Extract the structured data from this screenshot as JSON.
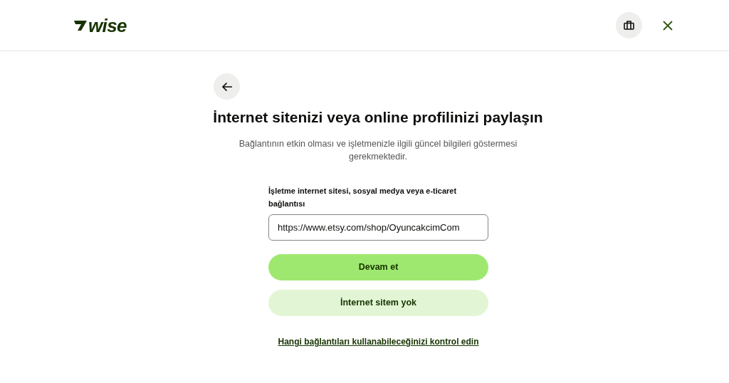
{
  "header": {
    "logo_text": "wise"
  },
  "title": "İnternet sitenizi veya online profilinizi paylaşın",
  "subtitle": "Bağlantının etkin olması ve işletmenizle ilgili güncel bilgileri göstermesi gerekmektedir.",
  "field": {
    "label": "İşletme internet sitesi, sosyal medya veya e-ticaret bağlantısı",
    "value": "https://www.etsy.com/shop/OyuncakcimCom"
  },
  "buttons": [
    {
      "label": "Devam et",
      "kind": "primary"
    },
    {
      "label": "İnternet sitem yok",
      "kind": "secondary"
    }
  ],
  "link": "Hangi bağlantıları kullanabileceğinizi kontrol edin"
}
